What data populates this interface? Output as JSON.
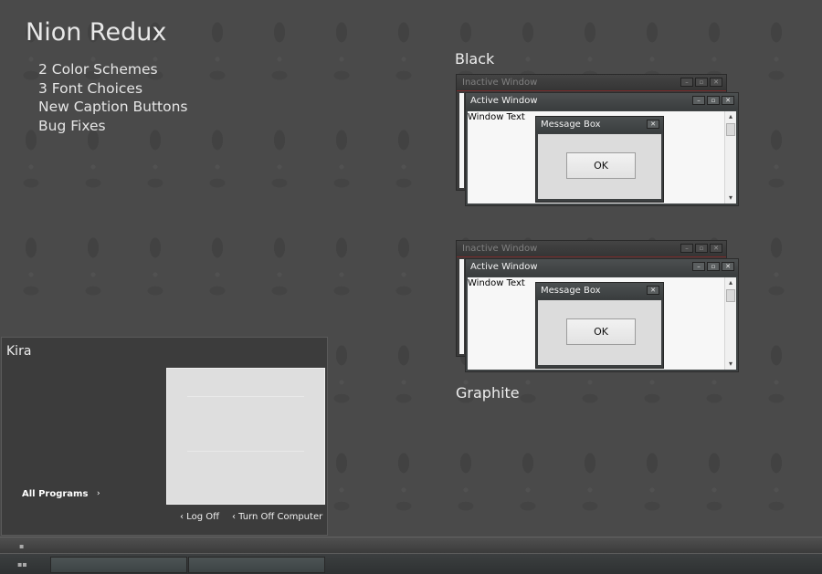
{
  "title": "Nion Redux",
  "features": [
    "2 Color Schemes",
    "3 Font Choices",
    "New Caption Buttons",
    "Bug Fixes"
  ],
  "schemes": [
    {
      "label": "Black",
      "inactive_title": "Inactive Window",
      "active_title": "Active Window",
      "window_text": "Window Text",
      "message_title": "Message Box",
      "ok_label": "OK"
    },
    {
      "label": "Graphite",
      "inactive_title": "Inactive Window",
      "active_title": "Active Window",
      "window_text": "Window Text",
      "message_title": "Message Box",
      "ok_label": "OK"
    }
  ],
  "caption_glyphs": {
    "minimize": "–",
    "maximize": "▫",
    "close": "✕"
  },
  "scroll_glyphs": {
    "up": "▴",
    "down": "▾"
  },
  "start_menu": {
    "user": "Kira",
    "all_programs": "All Programs",
    "all_programs_arrow": "›",
    "log_off": "‹ Log Off",
    "turn_off": "‹ Turn Off Computer"
  },
  "colors": {
    "desktop": "#4a4a4a",
    "active_titlebar": "#3f4344",
    "client": "#f7f7f7",
    "dialog_body": "#dcdcdc"
  }
}
